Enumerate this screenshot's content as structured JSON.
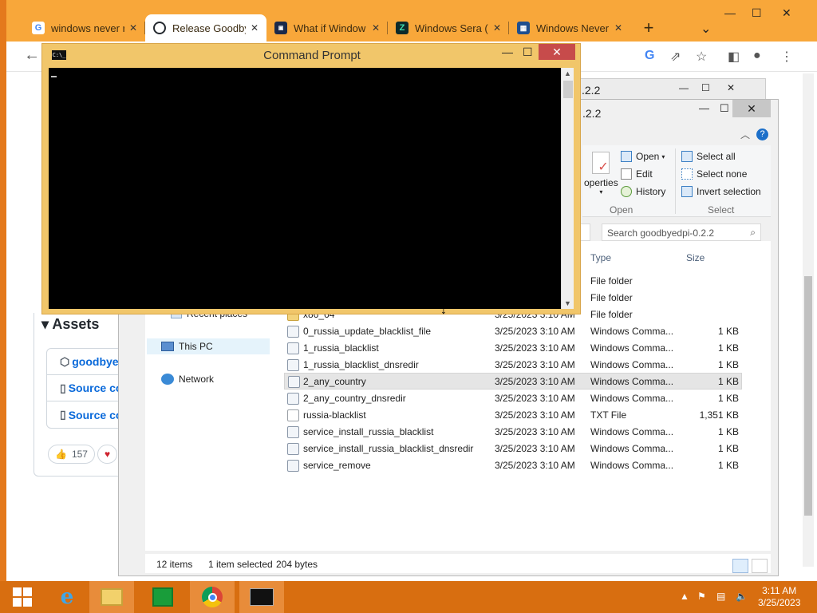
{
  "browser": {
    "tabs": [
      {
        "title": "windows never r",
        "favicon": "google-icon"
      },
      {
        "title": "Release Goodby",
        "favicon": "github-icon",
        "active": true
      },
      {
        "title": "What if Window",
        "favicon": "video-icon"
      },
      {
        "title": "Windows Sera (",
        "favicon": "s-icon"
      },
      {
        "title": "Windows Never",
        "favicon": "windows-icon"
      }
    ],
    "new_tab": "+",
    "window_controls": {
      "minimize": "—",
      "maximize": "☐",
      "close": "✕",
      "tab_search": "⌄"
    }
  },
  "github": {
    "assets_title": "Assets",
    "assets": [
      "goodbye",
      "Source co",
      "Source co"
    ],
    "reactions": [
      {
        "emoji": "👍",
        "count": "157"
      },
      {
        "emoji": "♥",
        "count": ""
      }
    ]
  },
  "cmd": {
    "title": "Command Prompt",
    "icon_text": "C:\\_"
  },
  "explorer": {
    "title_back": ".2.2",
    "title": ".2.2",
    "ribbon": {
      "properties_label": "operties",
      "open": "Open",
      "edit": "Edit",
      "history": "History",
      "select_all": "Select all",
      "select_none": "Select none",
      "invert_selection": "Invert selection",
      "group_open": "Open",
      "group_select": "Select"
    },
    "search_placeholder": "Search goodbyedpi-0.2.2",
    "columns": {
      "type": "Type",
      "size": "Size"
    },
    "nav": {
      "recent_places": "Recent places",
      "this_pc": "This PC",
      "network": "Network"
    },
    "files": [
      {
        "name": "",
        "date": "",
        "type": "File folder",
        "size": ""
      },
      {
        "name": "",
        "date": "",
        "type": "File folder",
        "size": ""
      },
      {
        "name": "x86_64",
        "date": "3/25/2023 3:10 AM",
        "type": "File folder",
        "size": ""
      },
      {
        "name": "0_russia_update_blacklist_file",
        "date": "3/25/2023 3:10 AM",
        "type": "Windows Comma...",
        "size": "1 KB"
      },
      {
        "name": "1_russia_blacklist",
        "date": "3/25/2023 3:10 AM",
        "type": "Windows Comma...",
        "size": "1 KB"
      },
      {
        "name": "1_russia_blacklist_dnsredir",
        "date": "3/25/2023 3:10 AM",
        "type": "Windows Comma...",
        "size": "1 KB"
      },
      {
        "name": "2_any_country",
        "date": "3/25/2023 3:10 AM",
        "type": "Windows Comma...",
        "size": "1 KB"
      },
      {
        "name": "2_any_country_dnsredir",
        "date": "3/25/2023 3:10 AM",
        "type": "Windows Comma...",
        "size": "1 KB"
      },
      {
        "name": "russia-blacklist",
        "date": "3/25/2023 3:10 AM",
        "type": "TXT File",
        "size": "1,351 KB"
      },
      {
        "name": "service_install_russia_blacklist",
        "date": "3/25/2023 3:10 AM",
        "type": "Windows Comma...",
        "size": "1 KB"
      },
      {
        "name": "service_install_russia_blacklist_dnsredir",
        "date": "3/25/2023 3:10 AM",
        "type": "Windows Comma...",
        "size": "1 KB"
      },
      {
        "name": "service_remove",
        "date": "3/25/2023 3:10 AM",
        "type": "Windows Comma...",
        "size": "1 KB"
      }
    ],
    "status": {
      "items": "12 items",
      "selected": "1 item selected",
      "bytes": "204 bytes"
    }
  },
  "taskbar": {
    "time": "3:11 AM",
    "date": "3/25/2023",
    "apps": [
      "start-button",
      "internet-explorer-icon",
      "file-explorer-icon",
      "store-icon",
      "chrome-icon",
      "cmd-icon"
    ]
  }
}
